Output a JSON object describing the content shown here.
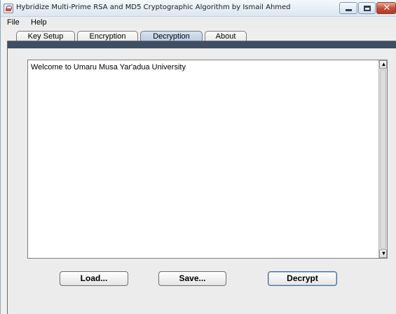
{
  "window": {
    "title": "Hybridize Multi-Prime RSA and MD5 Cryptographic Algorithm by Ismail Ahmed",
    "icon": "java-app-icon",
    "controls": {
      "minimize": "minimize-icon",
      "maximize": "maximize-icon",
      "close": "✕"
    }
  },
  "menu": [
    {
      "label": "File"
    },
    {
      "label": "Help"
    }
  ],
  "tabs": [
    {
      "label": "Key Setup",
      "active": false
    },
    {
      "label": "Encryption",
      "active": false
    },
    {
      "label": "Decryption",
      "active": true
    },
    {
      "label": "About",
      "active": false
    }
  ],
  "main": {
    "textarea_value": "Welcome to Umaru Musa Yar'adua University",
    "scroll_up": "▲",
    "scroll_down": "▼"
  },
  "buttons": {
    "load": "Load...",
    "save": "Save...",
    "decrypt": "Decrypt"
  },
  "colors": {
    "active_tab": "#c7d6e8",
    "panel_header": "#3e4e64",
    "close_button": "#c64a35"
  }
}
